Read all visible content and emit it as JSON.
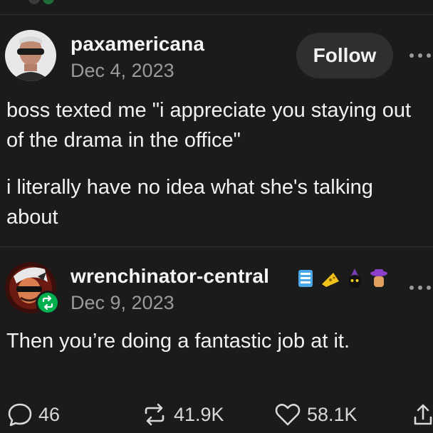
{
  "post": {
    "author": "paxamericana",
    "date": "Dec 4, 2023",
    "follow_label": "Follow",
    "paragraphs": [
      "boss texted me \"i appreciate you staying out of the drama in the office\"",
      "i literally have no idea what she's talking about"
    ]
  },
  "reply": {
    "author": "wrenchinator-central",
    "date": "Dec 9, 2023",
    "text": "Then you’re doing a fantastic job at it."
  },
  "actions": {
    "comments": "46",
    "reblogs": "41.9K",
    "likes": "58.1K"
  },
  "colors": {
    "background": "#1b1b1b",
    "follow_bg": "#2f2f2f",
    "reblog_green": "#00b04f",
    "muted": "#9a9a9a"
  },
  "icons": [
    "comment-icon",
    "reblog-icon",
    "heart-icon",
    "share-icon",
    "more-icon"
  ]
}
